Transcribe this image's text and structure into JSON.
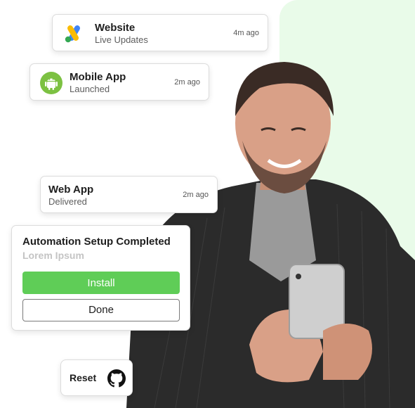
{
  "notifications": [
    {
      "title": "Website",
      "subtitle": "Live Updates",
      "time": "4m ago",
      "icon": "google-ads-icon"
    },
    {
      "title": "Mobile App",
      "subtitle": "Launched",
      "time": "2m ago",
      "icon": "android-icon"
    },
    {
      "title": "Web App",
      "subtitle": "Delivered",
      "time": "2m ago"
    }
  ],
  "setup": {
    "title": "Automation Setup Completed",
    "subtitle": "Lorem Ipsum",
    "install_label": "Install",
    "done_label": "Done"
  },
  "reset": {
    "label": "Reset",
    "icon": "github-icon"
  },
  "colors": {
    "accent_green": "#5fcd57",
    "panel_bg": "#e9fbe9",
    "android_green": "#7cc142"
  }
}
